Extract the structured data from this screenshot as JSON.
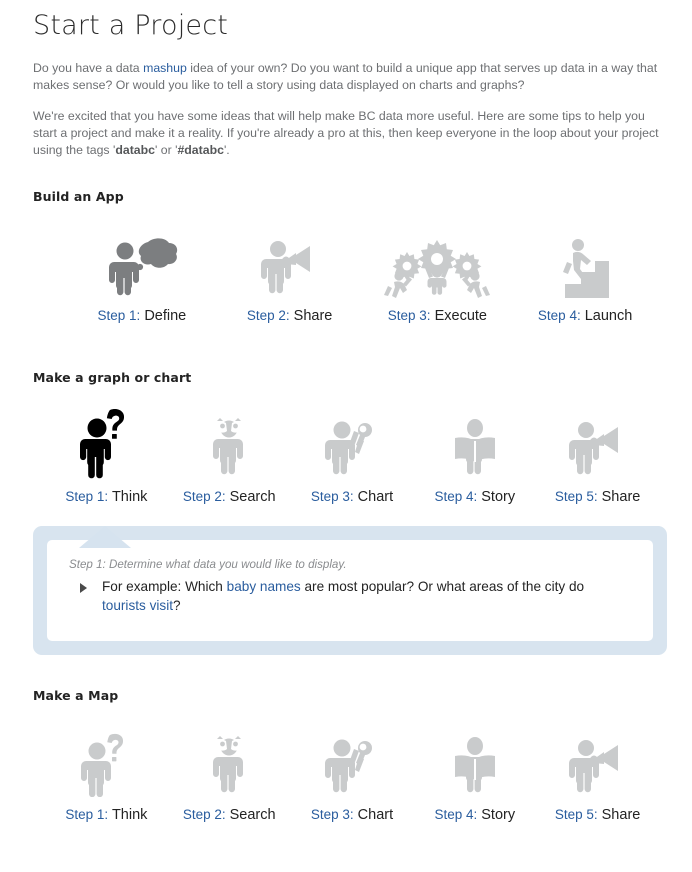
{
  "page": {
    "title": "Start a Project",
    "intro_1": {
      "part_a": "Do you have a data ",
      "link": "mashup",
      "part_b": " idea of your own? Do you want to build a unique app that serves up data in a way that makes sense? Or would you like to tell a story using data displayed on charts and graphs?"
    },
    "intro_2": {
      "part_a": "We're excited that you have some ideas that will help make BC data more useful. Here are some tips to help you start a project and make it a reality. If you're already a pro at this, then keep everyone in the loop about your project using the tags '",
      "tag_1": "databc",
      "part_b": "' or '",
      "tag_2": "#databc",
      "part_c": "'."
    }
  },
  "colors": {
    "link": "#2a5d9e",
    "icon_gray": "#c9cbcc",
    "icon_dark": "#7c7e80",
    "icon_active": "#000000",
    "callout_blue": "#d8e4ef"
  },
  "sections": [
    {
      "id": "build-an-app",
      "title": "Build an App",
      "steps": [
        {
          "num": "Step 1:",
          "name": "Define",
          "icon": "person-thought-cloud-icon",
          "state": "dark"
        },
        {
          "num": "Step 2:",
          "name": "Share",
          "icon": "person-megaphone-icon",
          "state": "gray"
        },
        {
          "num": "Step 3:",
          "name": "Execute",
          "icon": "people-gears-icon",
          "state": "gray"
        },
        {
          "num": "Step 4:",
          "name": "Launch",
          "icon": "person-stairs-icon",
          "state": "gray"
        }
      ]
    },
    {
      "id": "make-a-graph-or-chart",
      "title": "Make a graph or chart",
      "steps": [
        {
          "num": "Step 1:",
          "name": "Think",
          "icon": "person-question-mark-icon",
          "state": "active"
        },
        {
          "num": "Step 2:",
          "name": "Search",
          "icon": "person-binoculars-icon",
          "state": "gray"
        },
        {
          "num": "Step 3:",
          "name": "Chart",
          "icon": "person-wrench-icon",
          "state": "gray"
        },
        {
          "num": "Step 4:",
          "name": "Story",
          "icon": "person-book-icon",
          "state": "gray"
        },
        {
          "num": "Step 5:",
          "name": "Share",
          "icon": "person-megaphone-icon",
          "state": "gray"
        }
      ]
    },
    {
      "id": "make-a-map",
      "title": "Make a Map",
      "steps": [
        {
          "num": "Step 1:",
          "name": "Think",
          "icon": "person-question-mark-icon",
          "state": "gray"
        },
        {
          "num": "Step 2:",
          "name": "Search",
          "icon": "person-binoculars-icon",
          "state": "gray"
        },
        {
          "num": "Step 3:",
          "name": "Chart",
          "icon": "person-wrench-icon",
          "state": "gray"
        },
        {
          "num": "Step 4:",
          "name": "Story",
          "icon": "person-book-icon",
          "state": "gray"
        },
        {
          "num": "Step 5:",
          "name": "Share",
          "icon": "person-megaphone-icon",
          "state": "gray"
        }
      ]
    }
  ],
  "callout": {
    "lead": "Step 1: Determine what data you would like to display.",
    "item": {
      "part_a": "For example: Which ",
      "link_1": "baby names",
      "part_b": " are most popular? Or what areas of the city do ",
      "link_2": "tourists visit",
      "part_c": "?"
    }
  }
}
